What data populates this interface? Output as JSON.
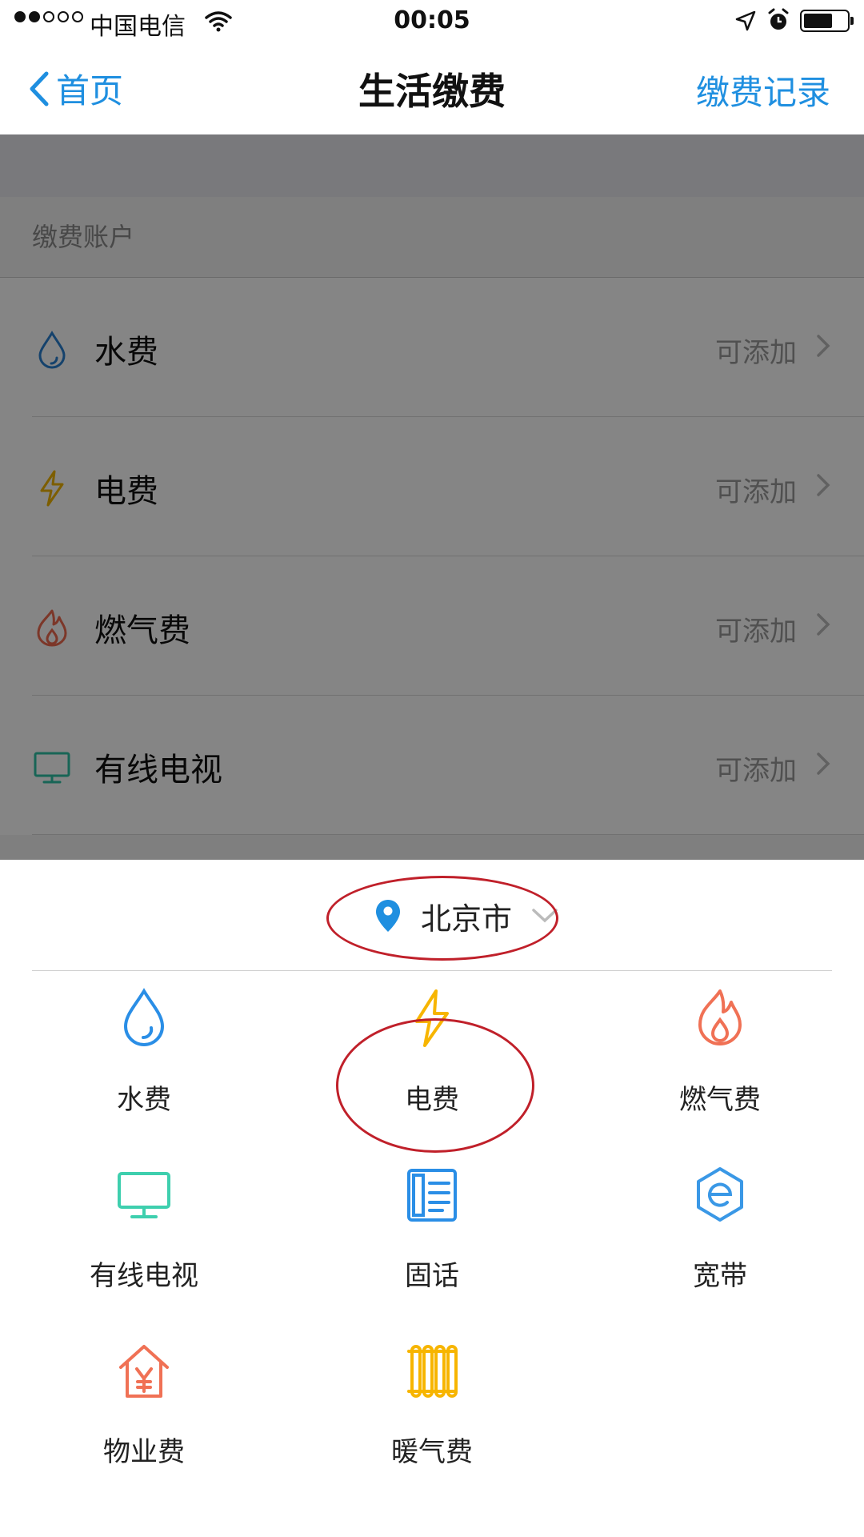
{
  "status_bar": {
    "carrier": "中国电信",
    "time": "00:05"
  },
  "nav": {
    "back_label": "首页",
    "title": "生活缴费",
    "right_label": "缴费记录"
  },
  "accounts": {
    "section_title": "缴费账户",
    "items": [
      {
        "label": "水费",
        "hint": "可添加",
        "icon": "water-drop-icon",
        "color": "#2a7fd0"
      },
      {
        "label": "电费",
        "hint": "可添加",
        "icon": "lightning-icon",
        "color": "#f0b400"
      },
      {
        "label": "燃气费",
        "hint": "可添加",
        "icon": "flame-icon",
        "color": "#ee6a4f"
      },
      {
        "label": "有线电视",
        "hint": "可添加",
        "icon": "tv-icon",
        "color": "#2fc2a5"
      }
    ]
  },
  "sheet": {
    "city": "北京市",
    "services": [
      {
        "label": "水费",
        "icon": "water-drop-icon",
        "color": "#2a8ee6"
      },
      {
        "label": "电费",
        "icon": "lightning-icon",
        "color": "#f7b500"
      },
      {
        "label": "燃气费",
        "icon": "flame-icon",
        "color": "#f07155"
      },
      {
        "label": "有线电视",
        "icon": "tv-icon",
        "color": "#3ecfae"
      },
      {
        "label": "固话",
        "icon": "phone-book-icon",
        "color": "#2a8ee6"
      },
      {
        "label": "宽带",
        "icon": "broadband-e-icon",
        "color": "#3a98e6"
      },
      {
        "label": "物业费",
        "icon": "house-yen-icon",
        "color": "#f07155"
      },
      {
        "label": "暖气费",
        "icon": "radiator-icon",
        "color": "#f7b500"
      }
    ]
  },
  "colors": {
    "accent": "#1f8fe0",
    "annotation": "#c0202a"
  }
}
